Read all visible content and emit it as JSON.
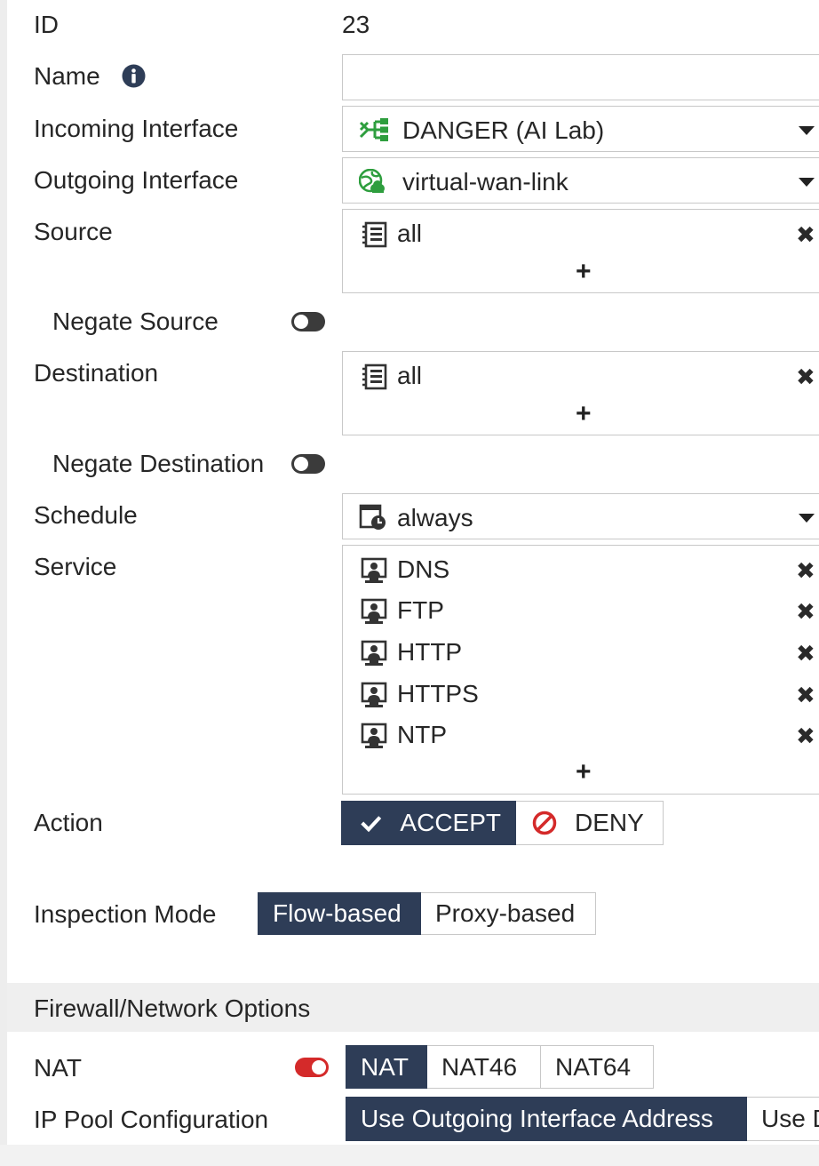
{
  "form": {
    "id": {
      "label": "ID",
      "value": "23"
    },
    "name": {
      "label": "Name",
      "value": "",
      "info_icon": "info-circle-icon"
    },
    "incoming_interface": {
      "label": "Incoming Interface",
      "value": "DANGER (AI Lab)",
      "icon": "network-switch-icon"
    },
    "outgoing_interface": {
      "label": "Outgoing Interface",
      "value": "virtual-wan-link",
      "icon": "globe-cloud-icon"
    },
    "source": {
      "label": "Source",
      "entries": [
        {
          "text": "all",
          "icon": "address-list-icon"
        }
      ],
      "add": "+",
      "remove": "✖"
    },
    "negate_source": {
      "label": "Negate Source",
      "enabled": false
    },
    "destination": {
      "label": "Destination",
      "entries": [
        {
          "text": "all",
          "icon": "address-list-icon"
        }
      ],
      "add": "+",
      "remove": "✖"
    },
    "negate_destination": {
      "label": "Negate Destination",
      "enabled": false
    },
    "schedule": {
      "label": "Schedule",
      "value": "always",
      "icon": "calendar-clock-icon"
    },
    "service": {
      "label": "Service",
      "entries": [
        {
          "text": "DNS",
          "icon": "service-icon"
        },
        {
          "text": "FTP",
          "icon": "service-icon"
        },
        {
          "text": "HTTP",
          "icon": "service-icon"
        },
        {
          "text": "HTTPS",
          "icon": "service-icon"
        },
        {
          "text": "NTP",
          "icon": "service-icon"
        }
      ],
      "add": "+",
      "remove": "✖"
    },
    "action": {
      "label": "Action",
      "accept": "ACCEPT",
      "deny": "DENY",
      "selected": "ACCEPT"
    },
    "inspection_mode": {
      "label": "Inspection Mode",
      "options": [
        "Flow-based",
        "Proxy-based"
      ],
      "selected": "Flow-based"
    }
  },
  "firewall_section": {
    "title": "Firewall/Network Options",
    "nat": {
      "label": "NAT",
      "enabled": true,
      "options": [
        "NAT",
        "NAT46",
        "NAT64"
      ],
      "selected": "NAT"
    },
    "ip_pool": {
      "label": "IP Pool Configuration",
      "options": [
        "Use Outgoing Interface Address",
        "Use D"
      ],
      "selected": "Use Outgoing Interface Address"
    }
  },
  "colors": {
    "accent": "#2e3d57",
    "toggle_on": "#d42a2a",
    "toggle_off": "#3b3b3b",
    "deny_red": "#d42a2a",
    "interface_green": "#2e9e3e"
  }
}
